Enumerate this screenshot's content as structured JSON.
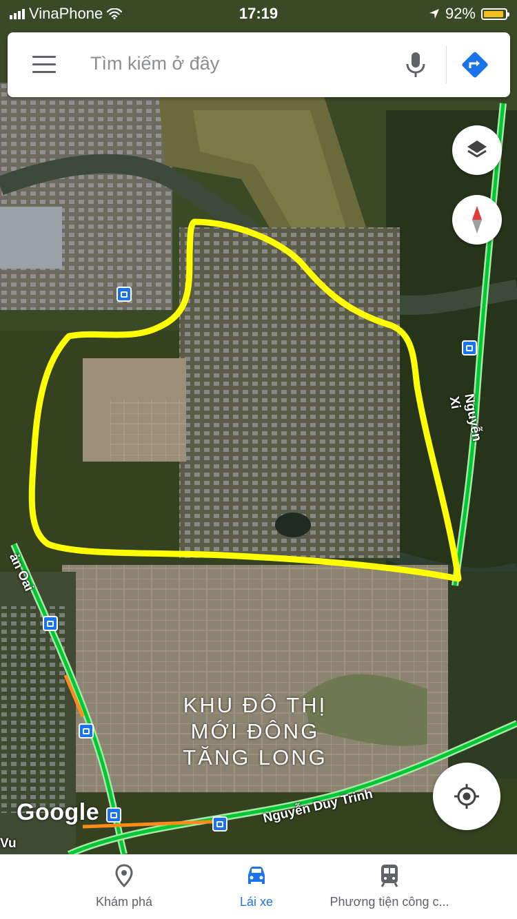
{
  "status_bar": {
    "carrier": "VinaPhone",
    "time": "17:19",
    "battery": "92%"
  },
  "search": {
    "placeholder": "Tìm kiếm ở đây"
  },
  "map": {
    "area_label": [
      "KHU ĐÔ THỊ",
      "MỚI ĐÔNG",
      "TĂNG LONG"
    ],
    "road_labels": [
      "Nguyễn Duy Trinh",
      "Nguyễn Xi",
      "ản Oai",
      "Vu"
    ],
    "google_logo": "Google"
  },
  "bottom_nav": [
    {
      "label": "Khám phá",
      "icon": "place-pin-icon",
      "active": false
    },
    {
      "label": "Lái xe",
      "icon": "car-icon",
      "active": true
    },
    {
      "label": "Phương tiện công c...",
      "icon": "transit-icon",
      "active": false
    }
  ],
  "colors": {
    "accent": "#1a73e8",
    "highlight": "#ffff00",
    "road": "#00e000"
  }
}
